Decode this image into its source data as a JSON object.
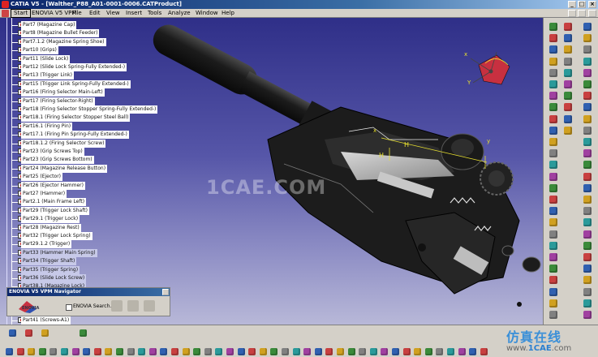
{
  "window": {
    "title": "CATIA V5 - [Walther_P88_A01-0001-0006.CATProduct]",
    "buttons": [
      "_",
      "□",
      "×"
    ]
  },
  "menubar": {
    "items": [
      "Start",
      "ENOVIA V5 VPM",
      "File",
      "Edit",
      "View",
      "Insert",
      "Tools",
      "Analyze",
      "Window",
      "Help"
    ]
  },
  "spec_tree": {
    "items": [
      {
        "label": "Part7 (Magazine Cap)",
        "selected": false
      },
      {
        "label": "Part8 (Magazine Bullet Feeder)",
        "selected": false
      },
      {
        "label": "Part7.1.2 (Magazine Spring Shoe)",
        "selected": false
      },
      {
        "label": "Part10 (Grips)",
        "selected": false
      },
      {
        "label": "Part11 (Slide Lock)",
        "selected": false
      },
      {
        "label": "Part12 (Slide Lock Spring-Fully Extended-)",
        "selected": false
      },
      {
        "label": "Part13 (Trigger Link)",
        "selected": false
      },
      {
        "label": "Part15 (Trigger Link Spring-Fully Extended-)",
        "selected": false
      },
      {
        "label": "Part16 (Firing Selector Main-Left)",
        "selected": false
      },
      {
        "label": "Part17 (Firing Selector-Right)",
        "selected": false
      },
      {
        "label": "Part18 (Firing Selector Stopper Spring-Fully Extended-)",
        "selected": false
      },
      {
        "label": "Part18.1 (Firing Selector Stopper Steel Ball)",
        "selected": false
      },
      {
        "label": "Part16.1 (Firing Pin)",
        "selected": false
      },
      {
        "label": "Part17.1 (Firing Pin Spring-Fully Extended-)",
        "selected": false
      },
      {
        "label": "Part18.1.2 (Firing Selector Screw)",
        "selected": false
      },
      {
        "label": "Part23 (Grip Screws Top)",
        "selected": false
      },
      {
        "label": "Part23 (Grip Screws Bottom)",
        "selected": false
      },
      {
        "label": "Part24 (Magazine Release Button)",
        "selected": false
      },
      {
        "label": "Part25 (Ejector)",
        "selected": false
      },
      {
        "label": "Part26 (Ejector Hammer)",
        "selected": false
      },
      {
        "label": "Part27 (Hammer)",
        "selected": false
      },
      {
        "label": "Part2.1 (Main Frame Left)",
        "selected": false
      },
      {
        "label": "Part29 (Trigger Lock Shaft)",
        "selected": false
      },
      {
        "label": "Part29.1 (Trigger Lock)",
        "selected": false
      },
      {
        "label": "Part28 (Magazine Rest)",
        "selected": false
      },
      {
        "label": "Part32 (Trigger Lock Spring)",
        "selected": false
      },
      {
        "label": "Part29.1.2 (Trigger)",
        "selected": false
      },
      {
        "label": "Part33 (Hammer Main Spring)",
        "selected": true
      },
      {
        "label": "Part34 (Trigger Shaft)",
        "selected": true
      },
      {
        "label": "Part35 (Trigger Spring)",
        "selected": true
      },
      {
        "label": "Part36 (Slide Lock Screw)",
        "selected": true
      },
      {
        "label": "Part38.1 (Magazine Lock)",
        "selected": true
      }
    ],
    "last_item": "Part41 (Screws-A1)"
  },
  "enovia_panel": {
    "title": "ENOVIA V5 VPM Navigator",
    "logo": "ENOVIA",
    "search_label": "ENOVIA Search..."
  },
  "model_labels": {
    "x": "x",
    "y": "y",
    "h1": "H",
    "h2": "H"
  },
  "compass": {
    "x": "x",
    "y": "Y"
  },
  "watermark": {
    "center": "1CAE.COM",
    "cn": "仿真在线",
    "url_prefix": "www.",
    "url_main": "1CAE",
    "url_suffix": ".com"
  },
  "colors": {
    "title_bar": "#0a246a",
    "viewport_top": "#2f2f88",
    "viewport_bottom": "#b8b8d8",
    "selection": "#c7c9e8"
  }
}
